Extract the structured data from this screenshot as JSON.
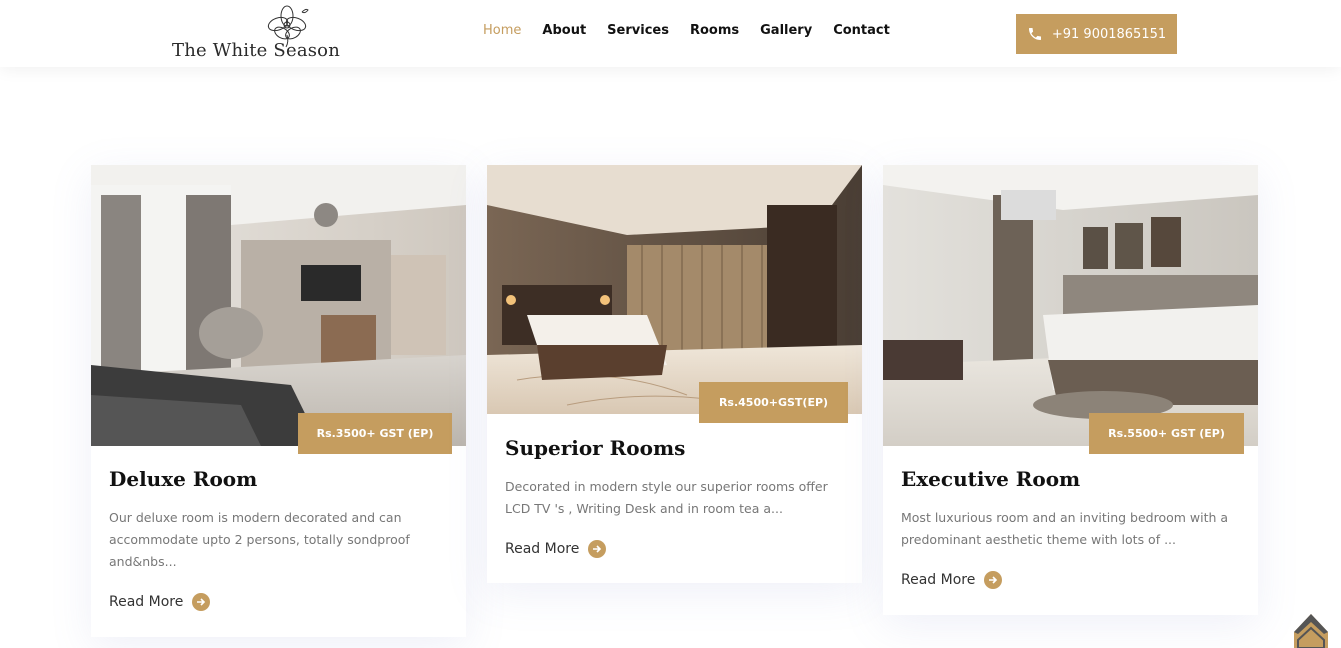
{
  "brand": {
    "name": "The White Season"
  },
  "nav": {
    "items": [
      {
        "label": "Home",
        "active": true
      },
      {
        "label": "About"
      },
      {
        "label": "Services"
      },
      {
        "label": "Rooms"
      },
      {
        "label": "Gallery"
      },
      {
        "label": "Contact"
      }
    ]
  },
  "header": {
    "phone_label": "+91 9001865151",
    "phone_icon": "phone-icon"
  },
  "colors": {
    "accent": "#c59d5f",
    "text": "#111111",
    "muted": "#777777"
  },
  "rooms": [
    {
      "title": "Deluxe Room",
      "price": "Rs.3500+ GST (EP)",
      "description": "Our deluxe room is modern decorated and can accommodate upto 2 persons, totally sondproof and&nbs...",
      "read_more": "Read More"
    },
    {
      "title": "Superior Rooms",
      "price": "Rs.4500+GST(EP)",
      "description": "Decorated in modern style our superior rooms offer LCD TV 's , Writing Desk and in room tea a...",
      "read_more": "Read More"
    },
    {
      "title": "Executive Room",
      "price": "Rs.5500+ GST (EP)",
      "description": "Most luxurious room and an inviting bedroom with a predominant aesthetic theme with lots of ...",
      "read_more": "Read More"
    }
  ]
}
